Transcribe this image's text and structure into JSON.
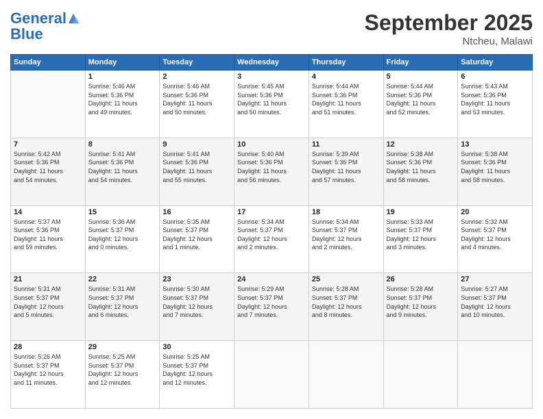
{
  "header": {
    "logo_line1": "General",
    "logo_line2": "Blue",
    "month": "September 2025",
    "location": "Ntcheu, Malawi"
  },
  "days_of_week": [
    "Sunday",
    "Monday",
    "Tuesday",
    "Wednesday",
    "Thursday",
    "Friday",
    "Saturday"
  ],
  "weeks": [
    [
      {
        "day": "",
        "info": ""
      },
      {
        "day": "1",
        "info": "Sunrise: 5:46 AM\nSunset: 5:36 PM\nDaylight: 11 hours\nand 49 minutes."
      },
      {
        "day": "2",
        "info": "Sunrise: 5:46 AM\nSunset: 5:36 PM\nDaylight: 11 hours\nand 50 minutes."
      },
      {
        "day": "3",
        "info": "Sunrise: 5:45 AM\nSunset: 5:36 PM\nDaylight: 11 hours\nand 50 minutes."
      },
      {
        "day": "4",
        "info": "Sunrise: 5:44 AM\nSunset: 5:36 PM\nDaylight: 11 hours\nand 51 minutes."
      },
      {
        "day": "5",
        "info": "Sunrise: 5:44 AM\nSunset: 5:36 PM\nDaylight: 11 hours\nand 52 minutes."
      },
      {
        "day": "6",
        "info": "Sunrise: 5:43 AM\nSunset: 5:36 PM\nDaylight: 11 hours\nand 53 minutes."
      }
    ],
    [
      {
        "day": "7",
        "info": "Sunrise: 5:42 AM\nSunset: 5:36 PM\nDaylight: 11 hours\nand 54 minutes."
      },
      {
        "day": "8",
        "info": "Sunrise: 5:41 AM\nSunset: 5:36 PM\nDaylight: 11 hours\nand 54 minutes."
      },
      {
        "day": "9",
        "info": "Sunrise: 5:41 AM\nSunset: 5:36 PM\nDaylight: 11 hours\nand 55 minutes."
      },
      {
        "day": "10",
        "info": "Sunrise: 5:40 AM\nSunset: 5:36 PM\nDaylight: 11 hours\nand 56 minutes."
      },
      {
        "day": "11",
        "info": "Sunrise: 5:39 AM\nSunset: 5:36 PM\nDaylight: 11 hours\nand 57 minutes."
      },
      {
        "day": "12",
        "info": "Sunrise: 5:38 AM\nSunset: 5:36 PM\nDaylight: 11 hours\nand 58 minutes."
      },
      {
        "day": "13",
        "info": "Sunrise: 5:38 AM\nSunset: 5:36 PM\nDaylight: 11 hours\nand 58 minutes."
      }
    ],
    [
      {
        "day": "14",
        "info": "Sunrise: 5:37 AM\nSunset: 5:36 PM\nDaylight: 11 hours\nand 59 minutes."
      },
      {
        "day": "15",
        "info": "Sunrise: 5:36 AM\nSunset: 5:37 PM\nDaylight: 12 hours\nand 0 minutes."
      },
      {
        "day": "16",
        "info": "Sunrise: 5:35 AM\nSunset: 5:37 PM\nDaylight: 12 hours\nand 1 minute."
      },
      {
        "day": "17",
        "info": "Sunrise: 5:34 AM\nSunset: 5:37 PM\nDaylight: 12 hours\nand 2 minutes."
      },
      {
        "day": "18",
        "info": "Sunrise: 5:34 AM\nSunset: 5:37 PM\nDaylight: 12 hours\nand 2 minutes."
      },
      {
        "day": "19",
        "info": "Sunrise: 5:33 AM\nSunset: 5:37 PM\nDaylight: 12 hours\nand 3 minutes."
      },
      {
        "day": "20",
        "info": "Sunrise: 5:32 AM\nSunset: 5:37 PM\nDaylight: 12 hours\nand 4 minutes."
      }
    ],
    [
      {
        "day": "21",
        "info": "Sunrise: 5:31 AM\nSunset: 5:37 PM\nDaylight: 12 hours\nand 5 minutes."
      },
      {
        "day": "22",
        "info": "Sunrise: 5:31 AM\nSunset: 5:37 PM\nDaylight: 12 hours\nand 6 minutes."
      },
      {
        "day": "23",
        "info": "Sunrise: 5:30 AM\nSunset: 5:37 PM\nDaylight: 12 hours\nand 7 minutes."
      },
      {
        "day": "24",
        "info": "Sunrise: 5:29 AM\nSunset: 5:37 PM\nDaylight: 12 hours\nand 7 minutes."
      },
      {
        "day": "25",
        "info": "Sunrise: 5:28 AM\nSunset: 5:37 PM\nDaylight: 12 hours\nand 8 minutes."
      },
      {
        "day": "26",
        "info": "Sunrise: 5:28 AM\nSunset: 5:37 PM\nDaylight: 12 hours\nand 9 minutes."
      },
      {
        "day": "27",
        "info": "Sunrise: 5:27 AM\nSunset: 5:37 PM\nDaylight: 12 hours\nand 10 minutes."
      }
    ],
    [
      {
        "day": "28",
        "info": "Sunrise: 5:26 AM\nSunset: 5:37 PM\nDaylight: 12 hours\nand 11 minutes."
      },
      {
        "day": "29",
        "info": "Sunrise: 5:25 AM\nSunset: 5:37 PM\nDaylight: 12 hours\nand 12 minutes."
      },
      {
        "day": "30",
        "info": "Sunrise: 5:25 AM\nSunset: 5:37 PM\nDaylight: 12 hours\nand 12 minutes."
      },
      {
        "day": "",
        "info": ""
      },
      {
        "day": "",
        "info": ""
      },
      {
        "day": "",
        "info": ""
      },
      {
        "day": "",
        "info": ""
      }
    ]
  ]
}
